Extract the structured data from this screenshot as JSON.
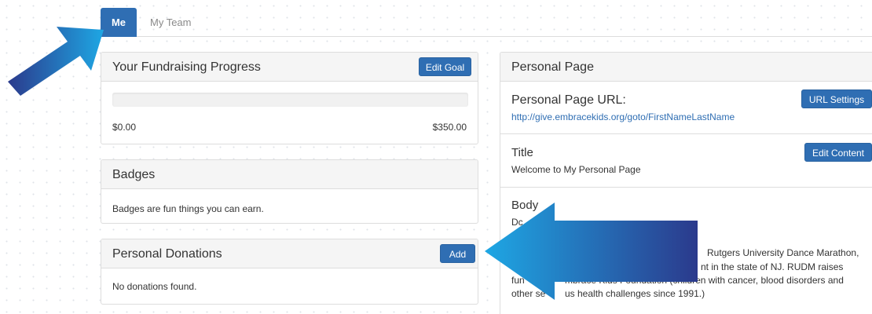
{
  "tabs": {
    "me": "Me",
    "team": "My Team"
  },
  "fundraising": {
    "title": "Your Fundraising Progress",
    "edit_goal": "Edit Goal",
    "progress_fraction": 0,
    "raised": "$0.00",
    "goal": "$350.00"
  },
  "badges": {
    "title": "Badges",
    "text": "Badges are fun things you can earn."
  },
  "donations": {
    "title": "Personal Donations",
    "add": "Add",
    "empty_text": "No donations found."
  },
  "personal_page": {
    "title": "Personal Page",
    "url_label": "Personal Page URL:",
    "url_settings": "URL Settings",
    "url": "http://give.embracekids.org/goto/FirstNameLastName",
    "title_label": "Title",
    "edit_content": "Edit Content",
    "title_value": "Welcome to My Personal Page",
    "body_label": "Body",
    "body_line1": "Dc",
    "body_line2": "Rutgers University Dance Marathon,",
    "body_line3": "nt in the state of NJ. RUDM raises",
    "body_line4a": "fun",
    "body_line4b": "mbrace Kids Foundation (children with cancer, blood disorders and",
    "body_line5a": "other se",
    "body_line5b": "us health challenges since 1991.)"
  },
  "colors": {
    "accent": "#2f6eb3",
    "arrow_dark": "#2b3a8c",
    "arrow_light": "#1ea7e4"
  }
}
